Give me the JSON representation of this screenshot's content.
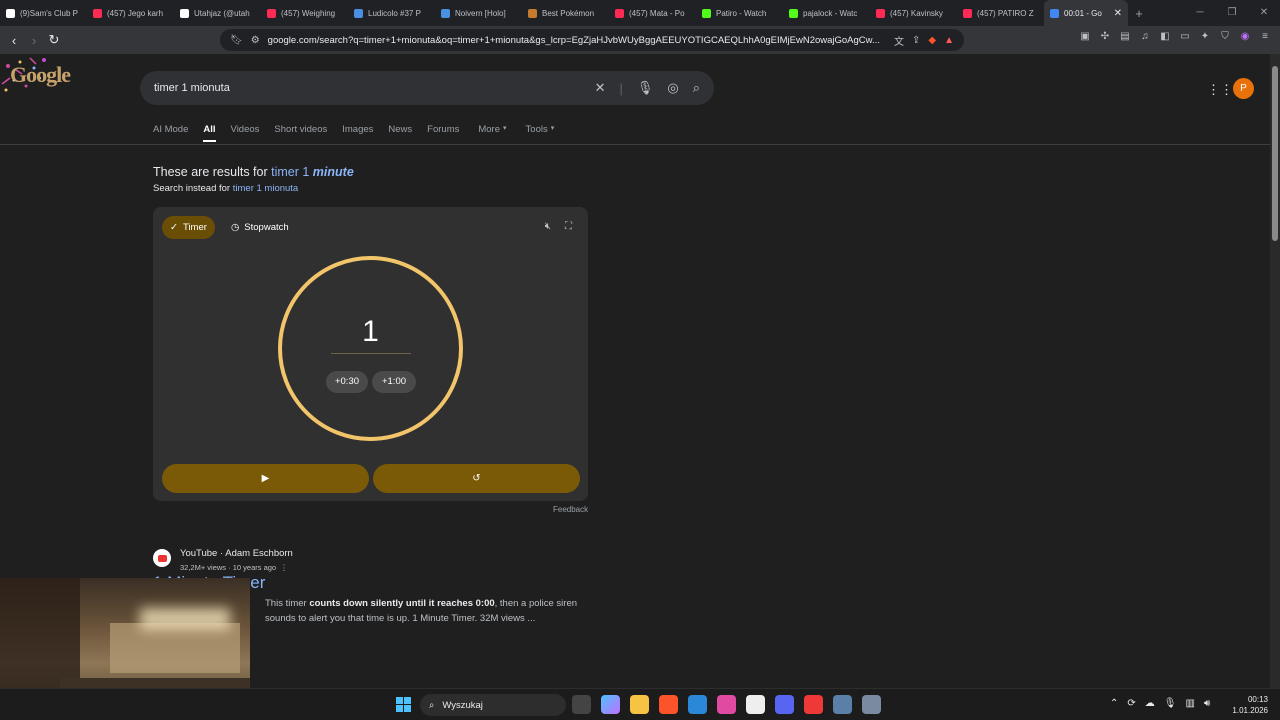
{
  "browser": {
    "tabs": [
      {
        "title": "(9)Sam's Club P",
        "icon": "tiktok-icon",
        "color": "#ffffff"
      },
      {
        "title": "(457) Jego karh",
        "icon": "youtube-icon",
        "color": "#ff2b55"
      },
      {
        "title": "Utahjaz (@utah",
        "icon": "tiktok-icon",
        "color": "#ffffff"
      },
      {
        "title": "(457) Weighing",
        "icon": "youtube-icon",
        "color": "#ff2b55"
      },
      {
        "title": "Ludicolo #37 P",
        "icon": "page-icon",
        "color": "#4a90e2"
      },
      {
        "title": "Noivern [Holo]",
        "icon": "page-icon",
        "color": "#4a90e2"
      },
      {
        "title": "Best Pokémon",
        "icon": "page-icon",
        "color": "#c57b2e"
      },
      {
        "title": "(457) Mata - Po",
        "icon": "youtube-icon",
        "color": "#ff2b55"
      },
      {
        "title": "Patiro - Watch",
        "icon": "kick-icon",
        "color": "#53fc18"
      },
      {
        "title": "pajalock - Watc",
        "icon": "kick-icon",
        "color": "#53fc18"
      },
      {
        "title": "(457) Kavinsky",
        "icon": "youtube-icon",
        "color": "#ff2b55"
      },
      {
        "title": "(457) PATIRO Z",
        "icon": "youtube-icon",
        "color": "#ff2b55"
      },
      {
        "title": "00:01 - Go",
        "icon": "google-icon",
        "color": "#4285f4",
        "active": true
      }
    ],
    "url": "google.com/search?q=timer+1+mionuta&oq=timer+1+mionuta&gs_lcrp=EgZjaHJvbWUyBggAEEUYOTIGCAEQLhhA0gEIMjEwN2owajGoAgCw..."
  },
  "google": {
    "logo_text": "Google",
    "query": "timer 1 mionuta",
    "avatar_letter": "P",
    "nav_tabs": [
      "AI Mode",
      "All",
      "Videos",
      "Short videos",
      "Images",
      "News",
      "Forums",
      "More",
      "Tools"
    ],
    "results_prefix": "These are results for ",
    "results_query_plain": "timer 1 ",
    "results_query_bold": "minute",
    "instead_prefix": "Search instead for ",
    "instead_query": "timer 1 mionuta"
  },
  "timer": {
    "tab_timer": "Timer",
    "tab_stopwatch": "Stopwatch",
    "value": "1",
    "add_30": "+0:30",
    "add_60": "+1:00",
    "feedback": "Feedback",
    "accent": "#f3c56b"
  },
  "video": {
    "source": "YouTube · Adam Eschborn",
    "meta": "32,2M+ views · 10 years ago",
    "title": "1 Minute Timer",
    "snippet_a": "This timer ",
    "snippet_b": "counts down silently until it reaches 0:00",
    "snippet_c": ", then a police siren sounds to alert you that time is up. 1 Minute Timer. 32M views ..."
  },
  "taskbar": {
    "search_placeholder": "Wyszukaj",
    "time": "00:13",
    "date": "1.01.2026"
  }
}
